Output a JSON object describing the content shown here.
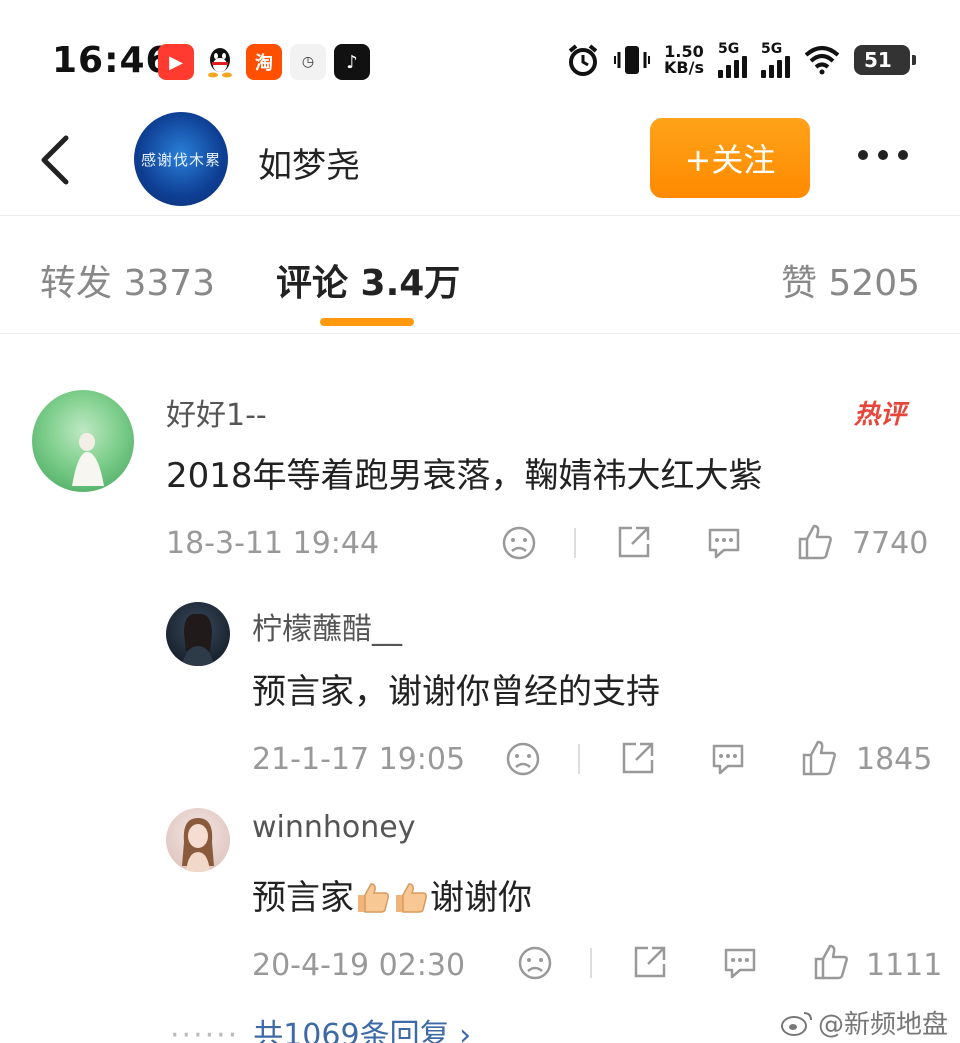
{
  "status_bar": {
    "time": "16:46",
    "net_speed_value": "1.50",
    "net_speed_unit": "KB/s",
    "sim1_label": "5G",
    "sim2_label": "5G",
    "battery": "51"
  },
  "header": {
    "username": "如梦尧",
    "avatar_text": "感谢伐木累",
    "follow_label": "+关注"
  },
  "tabs": {
    "repost": "转发 3373",
    "comments": "评论 3.4万",
    "likes": "赞 5205"
  },
  "comments": [
    {
      "user": "好好1--",
      "badge": "热评",
      "text": "2018年等着跑男衰落，鞠婧祎大红大紫",
      "time": "18-3-11 19:44",
      "likes": "7740"
    },
    {
      "user": "柠檬蘸醋__",
      "text": "预言家，谢谢你曾经的支持",
      "time": "21-1-17 19:05",
      "likes": "1845"
    },
    {
      "user": "winnhoney",
      "text_before": "预言家",
      "text_after": "谢谢你",
      "time": "20-4-19 02:30",
      "likes": "1111"
    }
  ],
  "replies_link": "共1069条回复",
  "watermark": "@新频地盘",
  "colors": {
    "accent": "#ff9a10",
    "link": "#3d6aa7",
    "hot": "#e8463a"
  }
}
